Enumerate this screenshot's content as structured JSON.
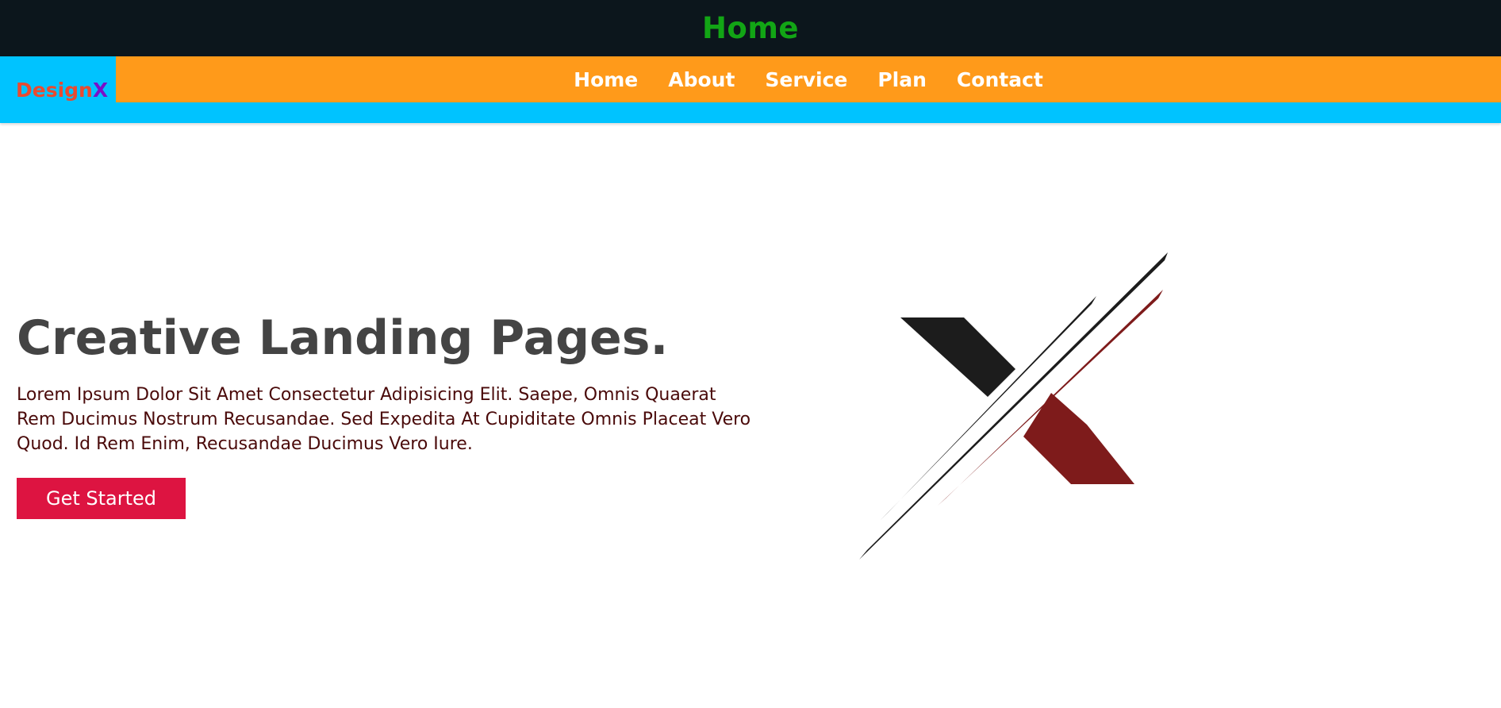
{
  "topbar": {
    "title": "Home"
  },
  "brand": {
    "part1": "Design",
    "part2": "X",
    "color1": "#ea4a2f",
    "color2": "#7a10c7"
  },
  "nav": {
    "items": [
      "Home",
      "About",
      "Service",
      "Plan",
      "Contact"
    ]
  },
  "hero": {
    "title": "Creative Landing Pages.",
    "description": "Lorem Ipsum Dolor Sit Amet Consectetur Adipisicing Elit. Saepe, Omnis Quaerat Rem Ducimus Nostrum Recusandae. Sed Expedita At Cupiditate Omnis Placeat Vero Quod. Id Rem Enim, Recusandae Ducimus Vero Iure.",
    "cta_label": "Get Started"
  },
  "hero_image": {
    "icon": "x-logo-icon",
    "colors": [
      "#1c1c1c",
      "#7e1b1b"
    ]
  },
  "colors": {
    "topbar_bg": "#0c161c",
    "title_green": "#12a515",
    "header_bg": "#00c3ff",
    "nav_bg": "#ff9a1a",
    "cta_bg": "#dd1441"
  }
}
